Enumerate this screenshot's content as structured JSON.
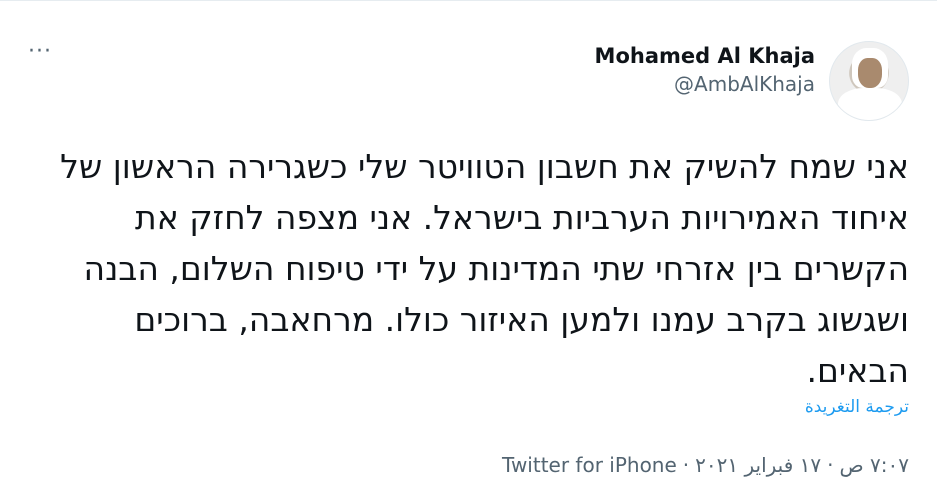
{
  "author": {
    "display_name": "Mohamed Al Khaja",
    "handle": "@AmbAlKhaja"
  },
  "more_menu_label": "···",
  "tweet_text": "אני שמח להשיק את חשבון הטוויטר שלי כשגרירה הראשון של איחוד האמירויות הערביות בישראל. אני מצפה לחזק את הקשרים בין אזרחי שתי המדינות על ידי טיפוח השלום, הבנה ושגשוג בקרב עמנו ולמען האיזור כולו. מרחאבה, ברוכים הבאים.",
  "translate_label": "ترجمة التغريدة",
  "meta": {
    "time": "٧:٠٧ ص",
    "date": "١٧ فبراير ٢٠٢١",
    "separator": "·",
    "source": "Twitter for iPhone"
  }
}
